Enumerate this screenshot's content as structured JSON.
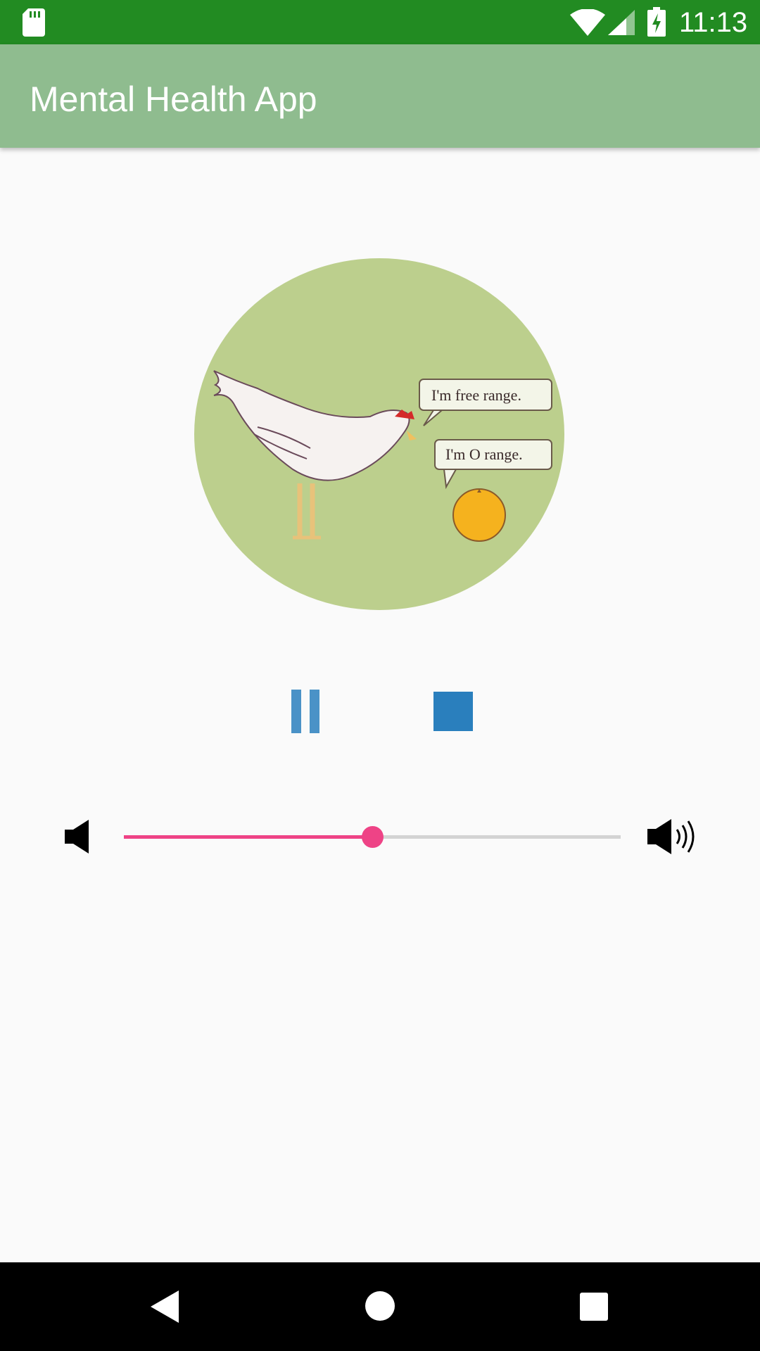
{
  "status_bar": {
    "time": "11:13",
    "icons": [
      "sd-card-icon",
      "wifi-icon",
      "cell-signal-icon",
      "battery-charging-icon"
    ]
  },
  "app_bar": {
    "title": "Mental Health App"
  },
  "artwork": {
    "speech_bubble_1": "I'm free range.",
    "speech_bubble_2": "I'm O range.",
    "background_color": "#bccf8d"
  },
  "controls": {
    "pause_icon": "pause-icon",
    "stop_icon": "stop-icon",
    "accent_color": "#2a7fbd"
  },
  "volume": {
    "level": 0.5,
    "min_icon": "volume-mute-icon",
    "max_icon": "volume-up-icon",
    "accent_color": "#ee4386"
  },
  "nav_bar": {
    "icons": [
      "back-icon",
      "home-icon",
      "recents-icon"
    ]
  }
}
